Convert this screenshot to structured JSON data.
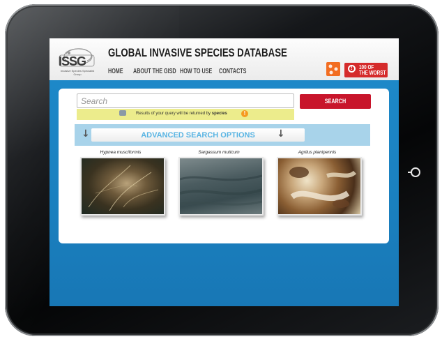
{
  "header": {
    "logo_text": "ISSG",
    "logo_subtext": "Invasive Species Specialist Group",
    "title": "GLOBAL INVASIVE SPECIES DATABASE",
    "nav": [
      "HOME",
      "ABOUT THE GISD",
      "HOW TO USE",
      "CONTACTS"
    ],
    "badge_line1": "100 OF",
    "badge_line2": "THE WORST"
  },
  "search": {
    "placeholder": "Search",
    "button_label": "SEARCH",
    "notice_prefix": "Results of your query will be returned by",
    "notice_mode": "species",
    "advanced_label": "ADVANCED SEARCH OPTIONS"
  },
  "species": [
    {
      "name": "Hypnea musciformis"
    },
    {
      "name": "Sargassum muticum"
    },
    {
      "name": "Agrilus planipennis"
    }
  ],
  "colors": {
    "screen_blue": "#1b85c4",
    "search_red": "#c8152b",
    "badge_red": "#d52b2b",
    "notice_yellow": "#ecec8c",
    "advanced_blue": "#a8d3ea",
    "advanced_text": "#58b4e3"
  },
  "icons": [
    "home-button-icon",
    "logo-lizard-icon",
    "orange-share-icon",
    "alert-circle-icon",
    "arrow-down-icon",
    "info-icon",
    "robot-icon"
  ]
}
